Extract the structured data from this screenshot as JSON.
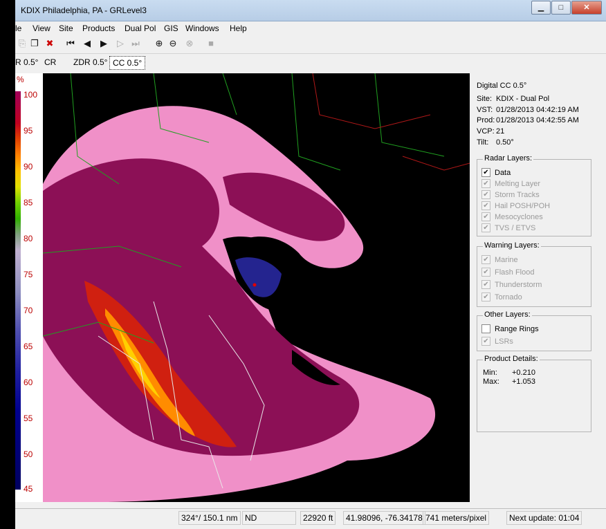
{
  "window": {
    "title": "KDIX Philadelphia, PA - GRLevel3",
    "min_symbol": "▁",
    "max_symbol": "□",
    "close_symbol": "✕"
  },
  "menu": [
    "le",
    "View",
    "Site",
    "Products",
    "Dual Pol",
    "GIS",
    "Windows",
    "Help"
  ],
  "toolbar": {
    "icons": [
      "copy-icon",
      "paste-icon",
      "delete-icon",
      "first-frame-icon",
      "prev-frame-icon",
      "play-icon",
      "last-frame-icon",
      "zoom-in-icon",
      "zoom-out-icon",
      "zoom-reset-icon",
      "stop-icon"
    ]
  },
  "tabs": [
    "R 0.5°",
    "CR",
    "ZDR 0.5°",
    "CC 0.5°"
  ],
  "active_tab": "CC 0.5°",
  "scale": {
    "unit": "%",
    "ticks": [
      "100",
      "95",
      "90",
      "85",
      "80",
      "75",
      "70",
      "65",
      "60",
      "55",
      "50",
      "45"
    ]
  },
  "info": {
    "product": "Digital CC 0.5°",
    "site_label": "Site:",
    "site": "KDIX - Dual Pol",
    "vst_label": "VST:",
    "vst": "01/28/2013  04:42:19 AM",
    "prod_label": "Prod:",
    "prod": "01/28/2013  04:42:55 AM",
    "vcp_label": "VCP:",
    "vcp": "21",
    "tilt_label": "Tilt:",
    "tilt": "0.50°"
  },
  "radar_layers": {
    "title": "Radar Layers:",
    "items": [
      {
        "label": "Data",
        "checked": true,
        "enabled": true
      },
      {
        "label": "Melting Layer",
        "checked": true,
        "enabled": false
      },
      {
        "label": "Storm Tracks",
        "checked": true,
        "enabled": false
      },
      {
        "label": "Hail POSH/POH",
        "checked": true,
        "enabled": false
      },
      {
        "label": "Mesocyclones",
        "checked": true,
        "enabled": false
      },
      {
        "label": "TVS / ETVS",
        "checked": true,
        "enabled": false
      }
    ]
  },
  "warning_layers": {
    "title": "Warning Layers:",
    "items": [
      {
        "label": "Marine",
        "checked": true,
        "enabled": false
      },
      {
        "label": "Flash Flood",
        "checked": true,
        "enabled": false
      },
      {
        "label": "Thunderstorm",
        "checked": true,
        "enabled": false
      },
      {
        "label": "Tornado",
        "checked": true,
        "enabled": false
      }
    ]
  },
  "other_layers": {
    "title": "Other Layers:",
    "items": [
      {
        "label": "Range Rings",
        "checked": false,
        "enabled": true
      },
      {
        "label": "LSRs",
        "checked": true,
        "enabled": false
      }
    ]
  },
  "product_details": {
    "title": "Product Details:",
    "min_label": "Min:",
    "min": "+0.210",
    "max_label": "Max:",
    "max": "+1.053"
  },
  "status": {
    "azimuth": "324°/ 150.1 nm",
    "value": "ND",
    "height": "22920 ft",
    "coords": "41.98096, -76.34178",
    "resolution": "741 meters/pixel",
    "next_update": "Next update: 01:04"
  }
}
